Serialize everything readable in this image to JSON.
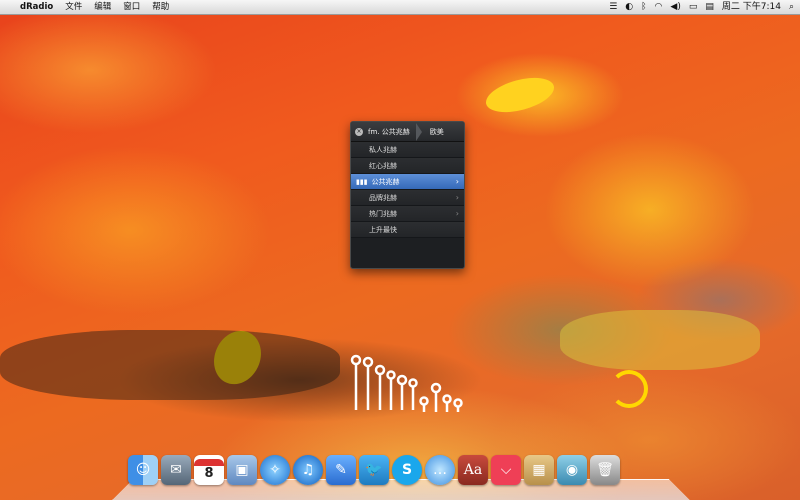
{
  "menubar": {
    "apple": "",
    "items": [
      "dRadio",
      "文件",
      "编辑",
      "窗口",
      "帮助"
    ],
    "clock": "周二 下午7:14"
  },
  "popup": {
    "breadcrumb_1": "fm. 公共兆赫",
    "breadcrumb_2": "欧美",
    "rows": [
      "私人兆赫",
      "红心兆赫",
      "公共兆赫",
      "品牌兆赫",
      "热门兆赫",
      "上升最快"
    ],
    "selected_index": 2
  },
  "dock": {
    "icons": [
      "finder-icon",
      "mail-stamp-icon",
      "calendar-icon",
      "preview-icon",
      "safari-icon",
      "itunes-icon",
      "xcode-icon",
      "twitter-bird-icon",
      "skype-icon",
      "messages-icon",
      "dictionary-icon",
      "pocket-icon",
      "package-icon",
      "camera-icon",
      "trash-icon"
    ],
    "calendar_day": "8"
  },
  "colors": {
    "accent": "#3569b8",
    "menubar": "#e0e0e0"
  }
}
